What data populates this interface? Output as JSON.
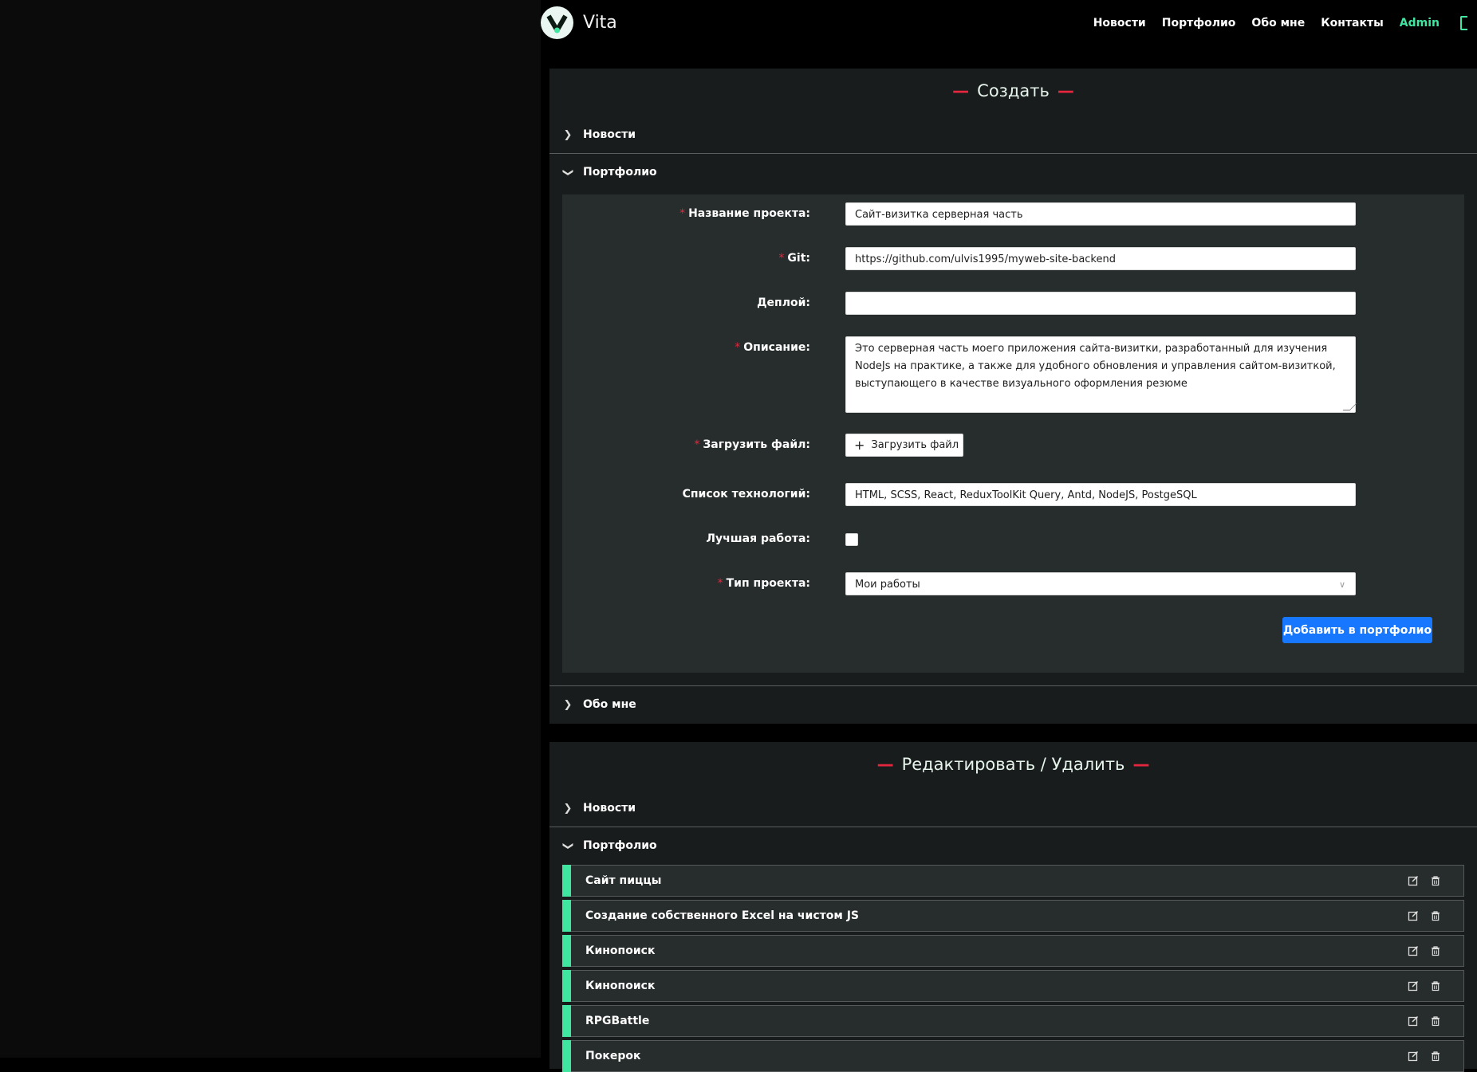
{
  "header": {
    "logo_text": "Vita",
    "nav": [
      "Новости",
      "Портфолио",
      "Обо мне",
      "Контакты",
      "Admin"
    ]
  },
  "create": {
    "title": "Создать",
    "dash": "—",
    "sections": {
      "news": "Новости",
      "portfolio": "Портфолио",
      "about": "Обо мне"
    },
    "form": {
      "project_name_label": "Название проекта",
      "project_name_value": "Сайт-визитка серверная часть",
      "git_label": "Git",
      "git_value": "https://github.com/ulvis1995/myweb-site-backend",
      "deploy_label": "Деплой",
      "deploy_value": "",
      "description_label": "Описание",
      "description_value": "Это серверная часть моего приложения сайта-визитки, разработанный для изучения NodeJs на практике, а также для удобного обновления и управления сайтом-визиткой, выступающего в качестве визуального оформления резюме",
      "upload_label": "Загрузить файл",
      "upload_button": "Загрузить файл",
      "tech_label": "Список технологий",
      "tech_value": "HTML, SCSS, React, ReduxToolKit Query, Antd, NodeJS, PostgeSQL",
      "best_label": "Лучшая работа",
      "best_checked": false,
      "type_label": "Тип проекта",
      "type_value": "Мои работы",
      "colon": ":",
      "required_mark": "*",
      "submit": "Добавить в портфолио"
    }
  },
  "edit": {
    "title": "Редактировать / Удалить",
    "sections": {
      "news": "Новости",
      "portfolio": "Портфолио"
    },
    "items": [
      "Сайт пиццы",
      "Создание собственного Excel на чистом JS",
      "Кинопоиск",
      "Кинопоиск",
      "RPGBattle",
      "Покерок"
    ]
  },
  "icons": {
    "chevron_right": "chevron-right-icon",
    "chevron_down": "chevron-down-icon",
    "edit": "edit-icon",
    "delete": "trash-icon"
  },
  "colors": {
    "accent_green": "#40e5a0",
    "accent_red": "#e5263e",
    "primary_blue": "#1778ff",
    "panel_bg": "#181c1c",
    "form_bg": "#272d2c"
  }
}
